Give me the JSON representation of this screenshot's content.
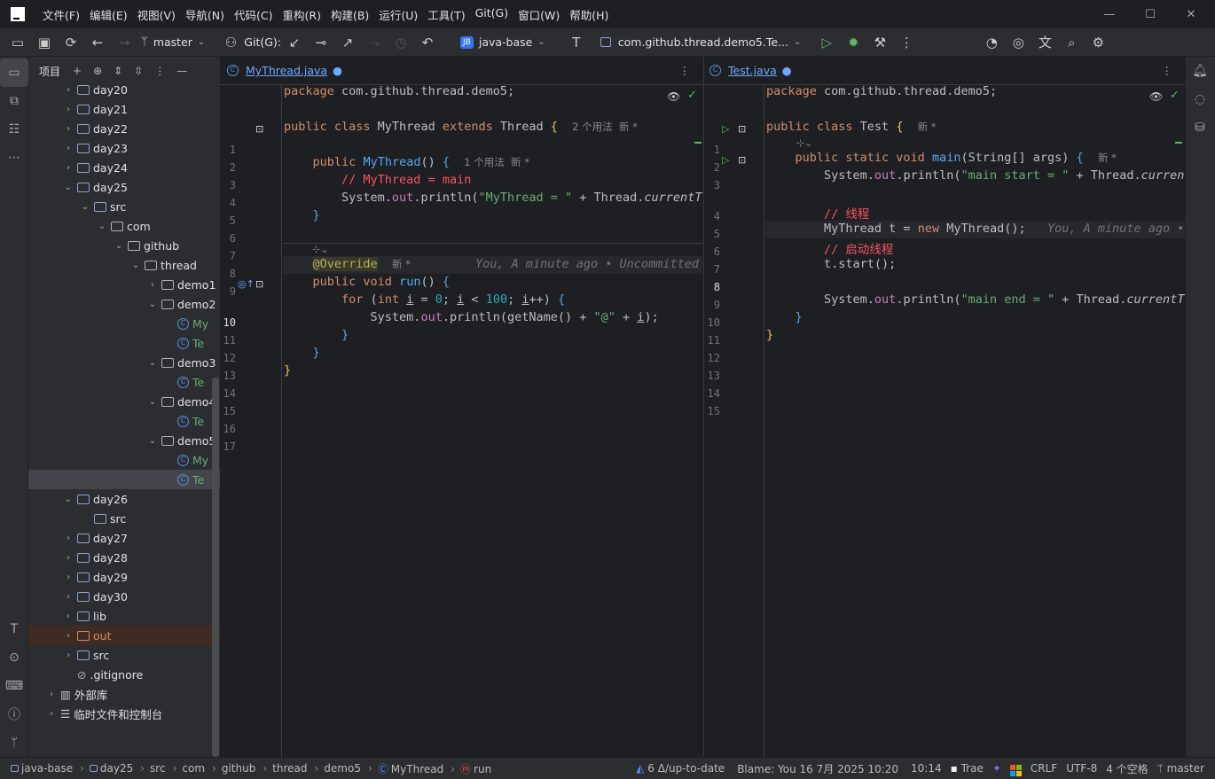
{
  "menu": [
    "文件(F)",
    "编辑(E)",
    "视图(V)",
    "导航(N)",
    "代码(C)",
    "重构(R)",
    "构建(B)",
    "运行(U)",
    "工具(T)",
    "Git(G)",
    "窗口(W)",
    "帮助(H)"
  ],
  "toolbar": {
    "branch": "master",
    "git_label": "Git(G):",
    "project_badge": "JB",
    "project": "java-base",
    "run_config": "com.github.thread.demo5.Te..."
  },
  "project_panel": {
    "title": "项目"
  },
  "tree": [
    {
      "label": "day20",
      "indent": 2,
      "arrow": "›",
      "type": "folder"
    },
    {
      "label": "day21",
      "indent": 2,
      "arrow": "›",
      "type": "folder"
    },
    {
      "label": "day22",
      "indent": 2,
      "arrow": "›",
      "type": "folder"
    },
    {
      "label": "day23",
      "indent": 2,
      "arrow": "›",
      "type": "folder"
    },
    {
      "label": "day24",
      "indent": 2,
      "arrow": "›",
      "type": "folder"
    },
    {
      "label": "day25",
      "indent": 2,
      "arrow": "⌄",
      "type": "folder"
    },
    {
      "label": "src",
      "indent": 3,
      "arrow": "⌄",
      "type": "src"
    },
    {
      "label": "com",
      "indent": 4,
      "arrow": "⌄",
      "type": "pkg"
    },
    {
      "label": "github",
      "indent": 5,
      "arrow": "⌄",
      "type": "pkg"
    },
    {
      "label": "thread",
      "indent": 6,
      "arrow": "⌄",
      "type": "pkg"
    },
    {
      "label": "demo1",
      "indent": 7,
      "arrow": "›",
      "type": "pkg"
    },
    {
      "label": "demo2",
      "indent": 7,
      "arrow": "⌄",
      "type": "pkg"
    },
    {
      "label": "My",
      "indent": 8,
      "arrow": "",
      "type": "class",
      "color": "#6aab73"
    },
    {
      "label": "Te",
      "indent": 8,
      "arrow": "",
      "type": "class",
      "color": "#6aab73"
    },
    {
      "label": "demo3",
      "indent": 7,
      "arrow": "⌄",
      "type": "pkg"
    },
    {
      "label": "Te",
      "indent": 8,
      "arrow": "",
      "type": "class",
      "color": "#6aab73"
    },
    {
      "label": "demo4",
      "indent": 7,
      "arrow": "⌄",
      "type": "pkg"
    },
    {
      "label": "Te",
      "indent": 8,
      "arrow": "",
      "type": "class",
      "color": "#6aab73"
    },
    {
      "label": "demo5",
      "indent": 7,
      "arrow": "⌄",
      "type": "pkg"
    },
    {
      "label": "My",
      "indent": 8,
      "arrow": "",
      "type": "class",
      "color": "#6aab73"
    },
    {
      "label": "Te",
      "indent": 8,
      "arrow": "",
      "type": "class",
      "color": "#6aab73",
      "selected": true
    },
    {
      "label": "day26",
      "indent": 2,
      "arrow": "⌄",
      "type": "folder"
    },
    {
      "label": "src",
      "indent": 3,
      "arrow": "",
      "type": "src"
    },
    {
      "label": "day27",
      "indent": 2,
      "arrow": "›",
      "type": "folder"
    },
    {
      "label": "day28",
      "indent": 2,
      "arrow": "›",
      "type": "folder"
    },
    {
      "label": "day29",
      "indent": 2,
      "arrow": "›",
      "type": "folder"
    },
    {
      "label": "day30",
      "indent": 2,
      "arrow": "›",
      "type": "folder"
    },
    {
      "label": "lib",
      "indent": 2,
      "arrow": "›",
      "type": "folder"
    },
    {
      "label": "out",
      "indent": 2,
      "arrow": "›",
      "type": "out",
      "color": "#e08855",
      "out": true
    },
    {
      "label": "src",
      "indent": 2,
      "arrow": "›",
      "type": "folder"
    },
    {
      "label": ".gitignore",
      "indent": 2,
      "arrow": "",
      "type": "ignore"
    },
    {
      "label": "外部库",
      "indent": 1,
      "arrow": "›",
      "type": "lib"
    },
    {
      "label": "临时文件和控制台",
      "indent": 1,
      "arrow": "›",
      "type": "scratch"
    }
  ],
  "editor_left": {
    "tab": "MyThread.java",
    "line_numbers": [
      "1",
      "2",
      "3",
      "4",
      "5",
      "6",
      "7",
      "8",
      "9",
      "10",
      "11",
      "12",
      "13",
      "14",
      "15",
      "16",
      "17"
    ],
    "hint_3": "2 个用法  新 *",
    "hint_5": "1 个用法  新 *",
    "hint_10": "新 *",
    "blame_10": "You, A minute ago • Uncommitted c"
  },
  "editor_right": {
    "tab": "Test.java",
    "line_numbers": [
      "1",
      "2",
      "3",
      "4",
      "5",
      "6",
      "7",
      "8",
      "9",
      "10",
      "11",
      "12",
      "13",
      "14",
      "15"
    ],
    "hint_3": "新 *",
    "hint_4": "新 *",
    "blame_8": "You, A minute ago •"
  },
  "statusbar": {
    "crumbs": [
      "java-base",
      "day25",
      "src",
      "com",
      "github",
      "thread",
      "demo5",
      "MyThread",
      "run"
    ],
    "vcs": "6 Δ/up-to-date",
    "blame": "Blame: You 16 7月 2025 10:20",
    "position": "10:14",
    "trae": "Trae",
    "line_sep": "CRLF",
    "encoding": "UTF-8",
    "indent": "4 个空格",
    "branch": "master"
  }
}
